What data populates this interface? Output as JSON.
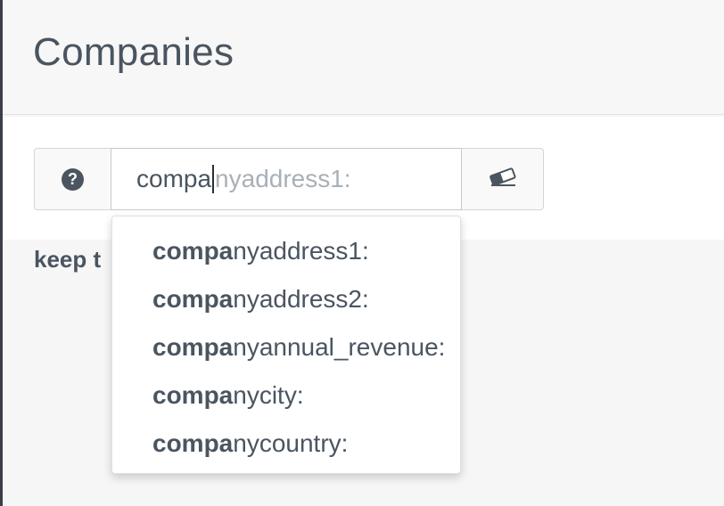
{
  "header": {
    "title": "Companies"
  },
  "search": {
    "typed": "compa",
    "completion_hint": "nyaddress1:"
  },
  "icons": {
    "help": "question-circle-icon",
    "clear": "eraser-icon"
  },
  "body": {
    "keep_text": "keep t"
  },
  "autocomplete": {
    "items": [
      {
        "match": "compa",
        "rest": "nyaddress1:"
      },
      {
        "match": "compa",
        "rest": "nyaddress2:"
      },
      {
        "match": "compa",
        "rest": "nyannual_revenue:"
      },
      {
        "match": "compa",
        "rest": "nycity:"
      },
      {
        "match": "compa",
        "rest": "nycountry:"
      }
    ]
  }
}
